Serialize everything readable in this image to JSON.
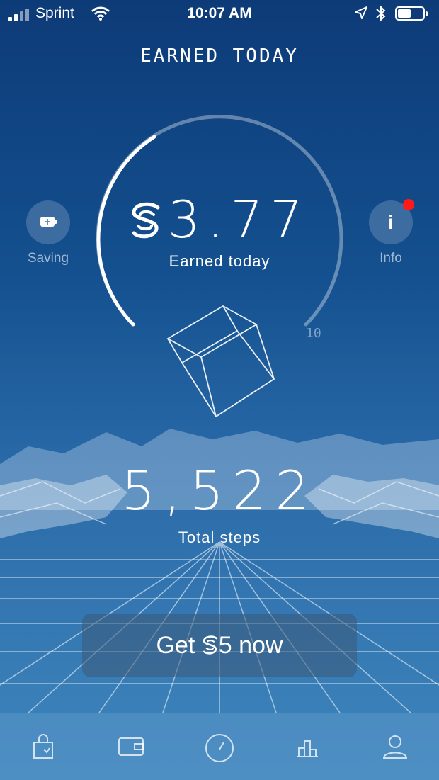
{
  "status_bar": {
    "carrier": "Sprint",
    "time": "10:07 AM"
  },
  "header": {
    "title": "EARNED TODAY"
  },
  "earnings": {
    "amount": "3.77",
    "label": "Earned today",
    "max_label": "10",
    "progress_fraction": 0.377
  },
  "side_buttons": {
    "saving_label": "Saving",
    "info_label": "Info",
    "info_icon_text": "i"
  },
  "steps": {
    "value": "5,522",
    "label": "Total steps"
  },
  "cta": {
    "prefix": "Get ",
    "amount": "5",
    "suffix": " now"
  },
  "tabbar": {
    "items": [
      {
        "icon": "shop-bag-icon"
      },
      {
        "icon": "wallet-icon"
      },
      {
        "icon": "speedometer-icon"
      },
      {
        "icon": "bar-chart-icon"
      },
      {
        "icon": "profile-icon"
      }
    ]
  },
  "colors": {
    "background_top": "#0d3b78",
    "background_bottom": "#3f86bd",
    "notification_dot": "#ff1a1a"
  }
}
